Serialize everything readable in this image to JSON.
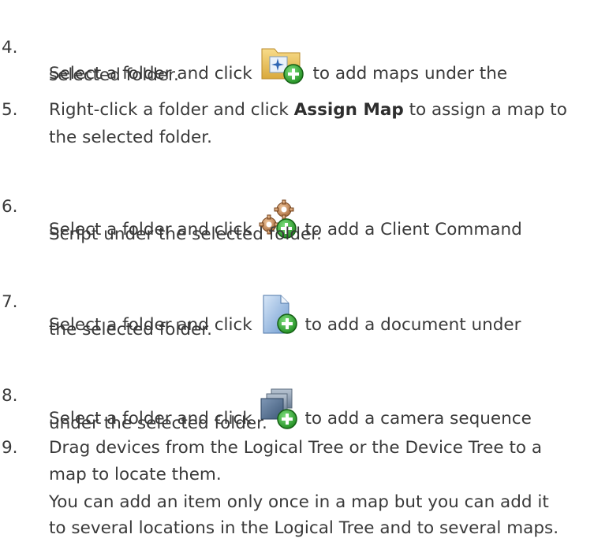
{
  "steps": [
    {
      "number": "4.",
      "line1_before_icon": "Select a folder and click",
      "line1_after_icon": "to add maps under the",
      "line2": "selected folder.",
      "icon": "add-map-folder-icon"
    },
    {
      "number": "5.",
      "line1_before_bold": "Right-click a folder and click",
      "bold": "Assign Map",
      "line1_after_bold": "to assign a map to",
      "line2": "the selected folder."
    },
    {
      "number": "6.",
      "line1_before_icon": "Select a folder and click",
      "line1_after_icon": "to add a Client Command",
      "line2": "Script under the selected folder.",
      "icon": "add-client-command-script-icon"
    },
    {
      "number": "7.",
      "line1_before_icon": "Select a folder and click",
      "line1_after_icon": "to add a document under",
      "line2": "the selected folder.",
      "icon": "add-document-icon"
    },
    {
      "number": "8.",
      "line1_before_icon": "Select a folder and click",
      "line1_after_icon": "to add a camera sequence",
      "line2": "under the selected folder.",
      "icon": "add-camera-sequence-icon"
    },
    {
      "number": "9.",
      "line1": "Drag devices from the Logical Tree or the Device Tree to a",
      "line2": "map to locate them.",
      "line3": "You can add an item only once in a map but you can add it",
      "line4": "to several locations in the Logical Tree and to several maps."
    }
  ],
  "colors": {
    "text": "#3a3a3a",
    "plus_green": "#2aa12a"
  }
}
